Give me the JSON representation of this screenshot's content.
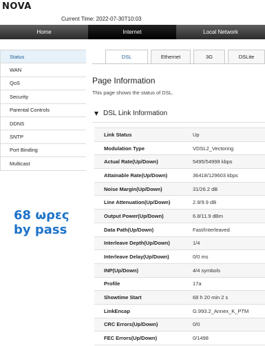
{
  "brand": {
    "logo_text": "NOVA"
  },
  "header": {
    "current_time": "Current Time: 2022-07-30T10:03"
  },
  "topnav": {
    "tabs": [
      {
        "label": "Home"
      },
      {
        "label": "Internet"
      },
      {
        "label": "Local Network"
      }
    ],
    "active": "Internet"
  },
  "sidebar": {
    "items": [
      {
        "label": "Status"
      },
      {
        "label": "WAN"
      },
      {
        "label": "QoS"
      },
      {
        "label": "Security"
      },
      {
        "label": "Parental Controls"
      },
      {
        "label": "DDNS"
      },
      {
        "label": "SNTP"
      },
      {
        "label": "Port Binding"
      },
      {
        "label": "Multicast"
      }
    ],
    "active": "Status"
  },
  "promo": {
    "line1": "68 ωρες",
    "line2": "by pass"
  },
  "subtabs": {
    "tabs": [
      {
        "label": "DSL"
      },
      {
        "label": "Ethernet"
      },
      {
        "label": "3G"
      },
      {
        "label": "DSLite"
      }
    ],
    "active": "DSL"
  },
  "page": {
    "title": "Page Information",
    "description": "This page shows the status of DSL."
  },
  "dsl": {
    "section_title": "DSL Link Information",
    "rows": [
      {
        "label": "Link Status",
        "value": "Up"
      },
      {
        "label": "Modulation Type",
        "value": "VDSL2_Vectoring"
      },
      {
        "label": "Actual Rate(Up/Down)",
        "value": "5495/54998 kbps"
      },
      {
        "label": "Attainable Rate(Up/Down)",
        "value": "36418/129603 kbps"
      },
      {
        "label": "Noise Margin(Up/Down)",
        "value": "31/26.2 dB"
      },
      {
        "label": "Line Attenuation(Up/Down)",
        "value": "2.9/9.9 dB"
      },
      {
        "label": "Output Power(Up/Down)",
        "value": "6.8/11.9 dBm"
      },
      {
        "label": "Data Path(Up/Down)",
        "value": "Fast/Interleaved"
      },
      {
        "label": "Interleave Depth(Up/Down)",
        "value": "1/4"
      },
      {
        "label": "Interleave Delay(Up/Down)",
        "value": "0/0 ms"
      },
      {
        "label": "INP(Up/Down)",
        "value": "4/4 symbols"
      },
      {
        "label": "Profile",
        "value": "17a"
      },
      {
        "label": "Showtime Start",
        "value": "68 h 20 min 2 s"
      },
      {
        "label": "LinkEncap",
        "value": "G.993.2_Annex_K_PTM"
      },
      {
        "label": "CRC Errors(Up/Down)",
        "value": "0/0"
      },
      {
        "label": "FEC Errors(Up/Down)",
        "value": "0/1498"
      }
    ]
  }
}
